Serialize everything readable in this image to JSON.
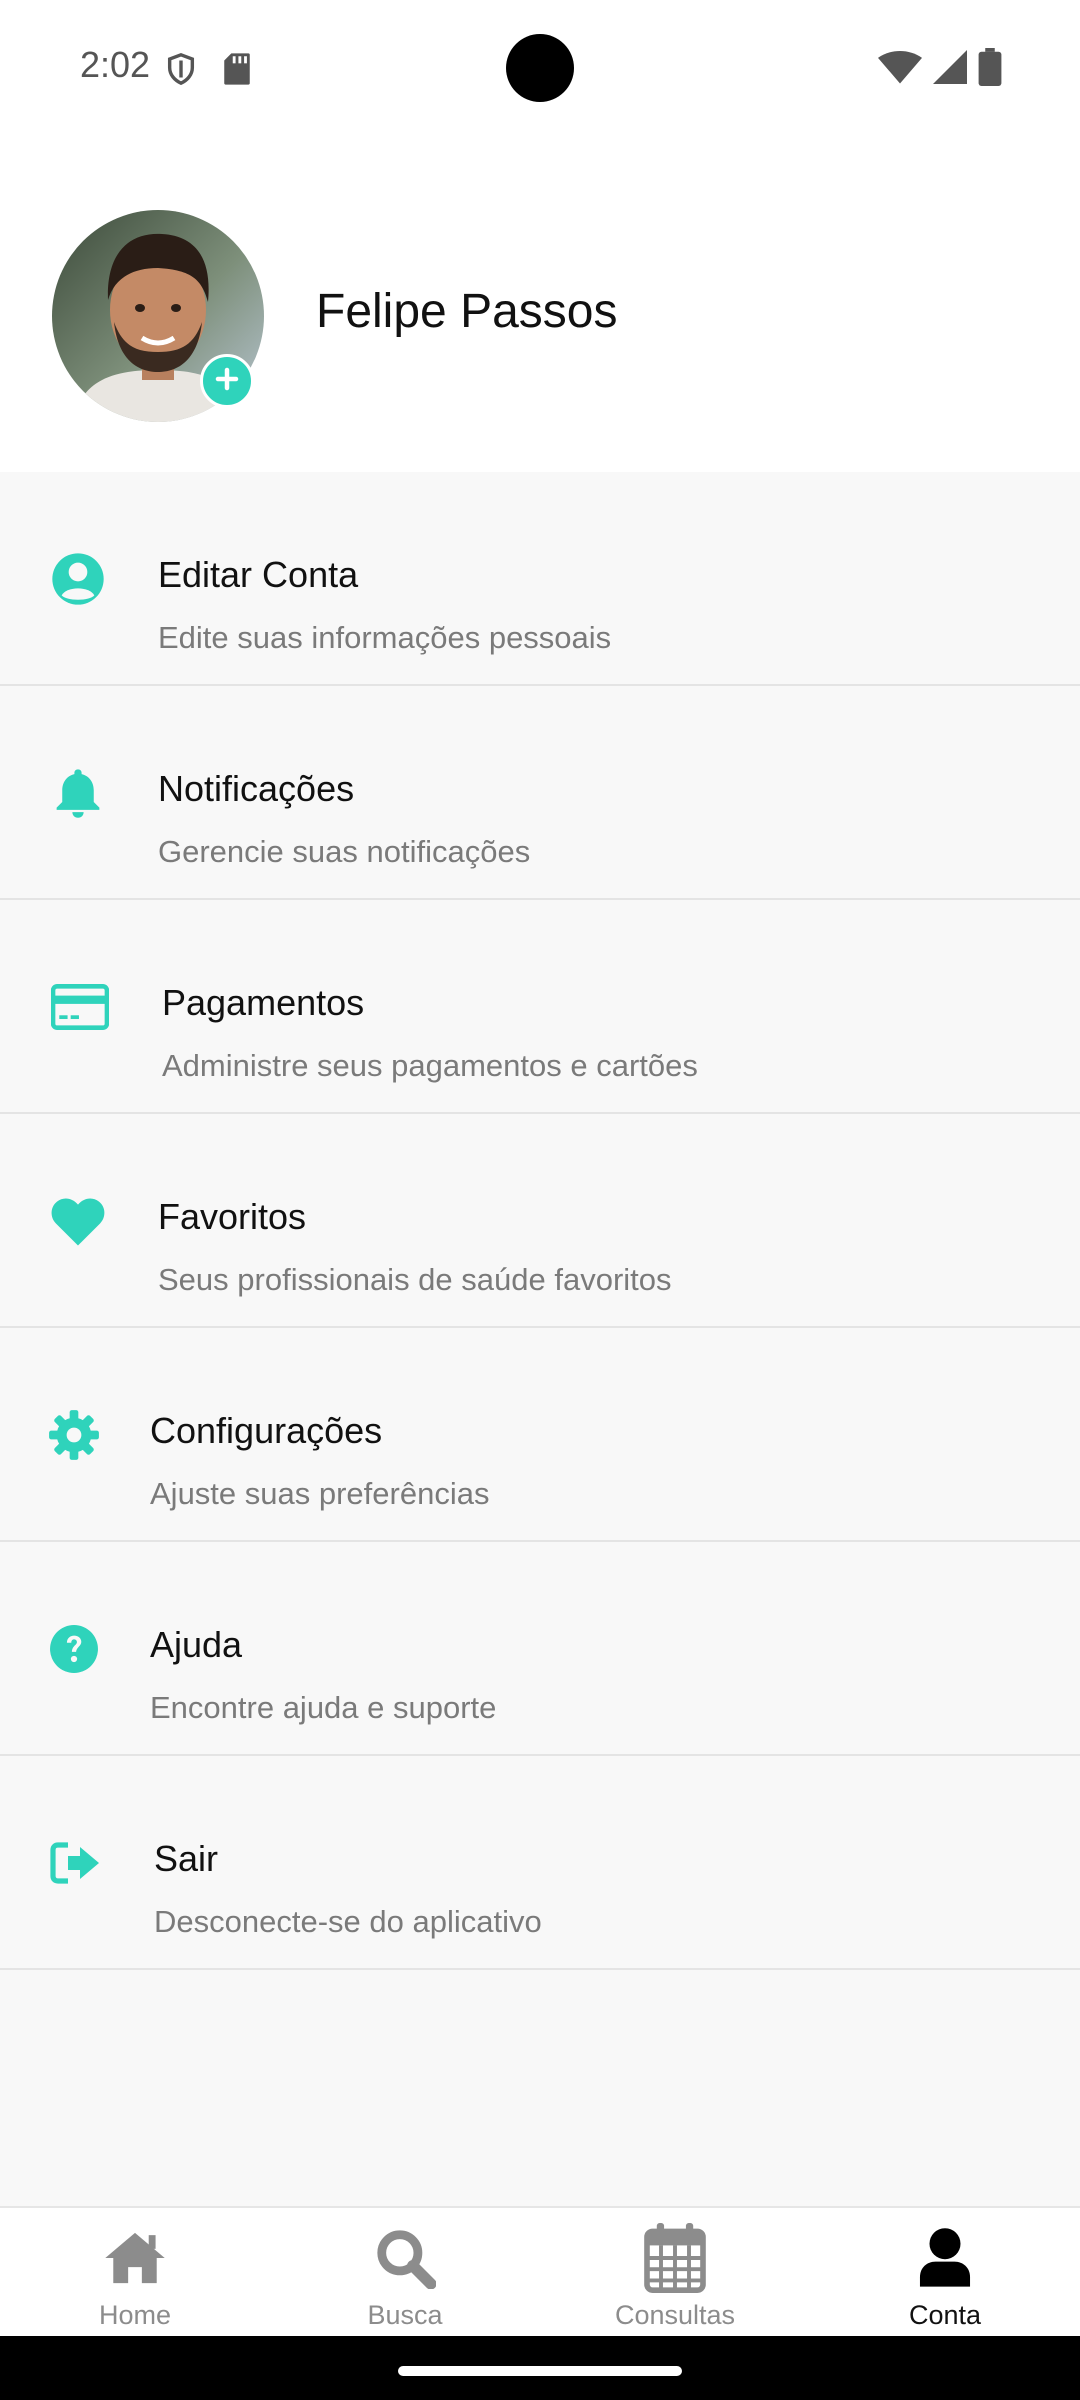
{
  "status": {
    "time": "2:02"
  },
  "profile": {
    "name": "Felipe Passos"
  },
  "menu": [
    {
      "title": "Editar Conta",
      "subtitle": "Edite suas informações pessoais",
      "icon": "account-circle-icon"
    },
    {
      "title": "Notificações",
      "subtitle": "Gerencie suas notificações",
      "icon": "bell-icon"
    },
    {
      "title": "Pagamentos",
      "subtitle": "Administre seus pagamentos e cartões",
      "icon": "credit-card-icon"
    },
    {
      "title": "Favoritos",
      "subtitle": "Seus profissionais de saúde favoritos",
      "icon": "heart-icon"
    },
    {
      "title": "Configurações",
      "subtitle": "Ajuste suas preferências",
      "icon": "gear-icon"
    },
    {
      "title": "Ajuda",
      "subtitle": "Encontre ajuda e suporte",
      "icon": "help-circle-icon"
    },
    {
      "title": "Sair",
      "subtitle": "Desconecte-se do aplicativo",
      "icon": "logout-icon"
    }
  ],
  "bottom_nav": [
    {
      "label": "Home",
      "icon": "home-icon",
      "active": false
    },
    {
      "label": "Busca",
      "icon": "search-icon",
      "active": false
    },
    {
      "label": "Consultas",
      "icon": "calendar-icon",
      "active": false
    },
    {
      "label": "Conta",
      "icon": "user-icon",
      "active": true
    }
  ],
  "colors": {
    "accent": "#2fd3bb",
    "nav_inactive": "#8c8c8c",
    "nav_active": "#111111"
  }
}
